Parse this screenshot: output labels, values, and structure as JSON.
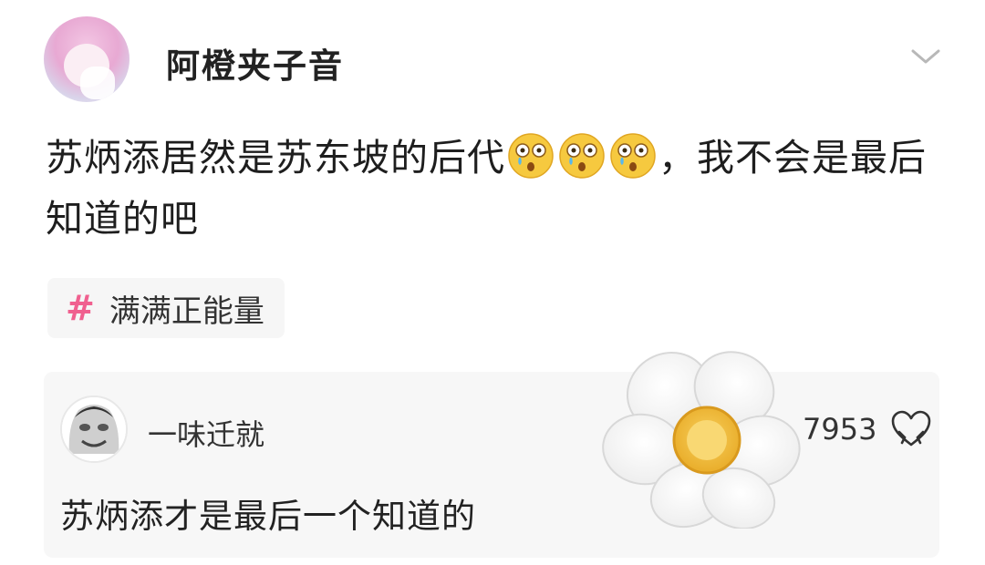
{
  "post": {
    "author": "阿橙夹子音",
    "text_part1": "苏炳添居然是苏东坡的后代",
    "emojis": [
      "crying-shocked-face-emoji",
      "crying-shocked-face-emoji",
      "crying-shocked-face-emoji"
    ],
    "text_part2": "，我不会是最后知道的吧",
    "tag": {
      "symbol": "#",
      "label": "满满正能量"
    }
  },
  "comment": {
    "author": "一味迁就",
    "text": "苏炳添才是最后一个知道的",
    "likes": "7953"
  },
  "colors": {
    "tag_hash": "#f0608f",
    "card_bg": "#f7f7f7"
  }
}
